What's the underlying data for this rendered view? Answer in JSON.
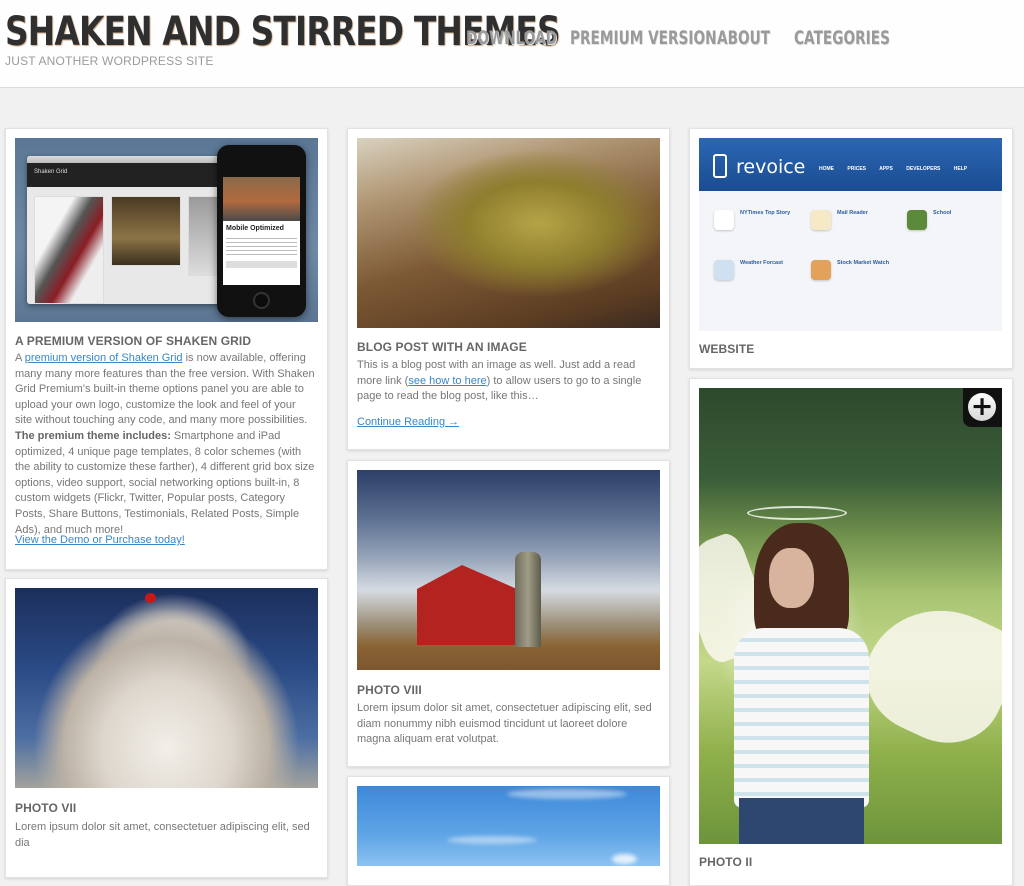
{
  "site": {
    "title": "SHAKEN AND STIRRED THEMES",
    "tagline": "JUST ANOTHER WORDPRESS SITE"
  },
  "nav": [
    {
      "label": "DOWNLOAD"
    },
    {
      "label": "PREMIUM VERSION"
    },
    {
      "label": "ABOUT"
    },
    {
      "label": "CATEGORIES"
    }
  ],
  "colors": {
    "background": "#f1f1f1",
    "link": "#3a86c8",
    "heading": "#666666",
    "body_text": "#777777",
    "nav_text": "#9a9a9a"
  },
  "posts": {
    "premium": {
      "title": "A PREMIUM VERSION OF SHAKEN GRID",
      "intro_prefix": "A ",
      "intro_link": "premium version of Shaken Grid",
      "intro_rest": " is now available, offering many many more features than the free version. With Shaken Grid Premium's built-in theme options panel you are able to upload your own logo, customize the look and feel of your site without touching any code, and many more possibilities. ",
      "bold": "The premium theme includes:",
      "features": " Smartphone and iPad optimized, 4 unique page templates, 8 color schemes (with the ability to customize these farther), 4 different grid box size options, video support, social networking options built-in, 8 custom widgets (Flickr, Twitter, Popular posts, Category Posts, Share Buttons, Testimonials, Related Posts, Simple Ads), and much more!",
      "cta_link": "View the Demo or Purchase today!",
      "image": {
        "alt": "Shaken Grid premium preview",
        "browser_title": "Shaken Grid",
        "phone_heading": "Mobile Optimized"
      }
    },
    "blog_image": {
      "title": "BLOG POST WITH AN IMAGE",
      "text_prefix": "This is a blog post with an image as well. Just add a read more link (",
      "text_link": "see how to here",
      "text_rest": ") to allow users to go to a single page to read the blog post, like this…",
      "read_more": "Continue Reading →",
      "image_alt": "Woman on a chaise lounge"
    },
    "website": {
      "title": "WEBSITE",
      "image": {
        "logo": "revoice",
        "menu": "HOME PRICES APPS DEVELOPERS HELP",
        "apps": [
          {
            "name": "NYTimes Top Story"
          },
          {
            "name": "Mail Reader"
          },
          {
            "name": "School"
          },
          {
            "name": "Weather Forcast"
          },
          {
            "name": "Stock Market Watch"
          }
        ]
      }
    },
    "photo_vii": {
      "title": "PHOTO VII",
      "text": "Lorem ipsum dolor sit amet, consectetuer adipiscing elit, sed dia",
      "image_alt": "Cloud with a cherry on top"
    },
    "photo_viii": {
      "title": "PHOTO VIII",
      "text": "Lorem ipsum dolor sit amet, consectetuer adipiscing elit, sed diam nonummy nibh euismod tincidunt ut laoreet dolore magna aliquam erat volutpat.",
      "image_alt": "Red barn and silo"
    },
    "photo_ii": {
      "title": "PHOTO II",
      "image_alt": "Girl with angel wings",
      "zoom_icon": "+"
    },
    "sky": {
      "image_alt": "Blue sky"
    }
  }
}
